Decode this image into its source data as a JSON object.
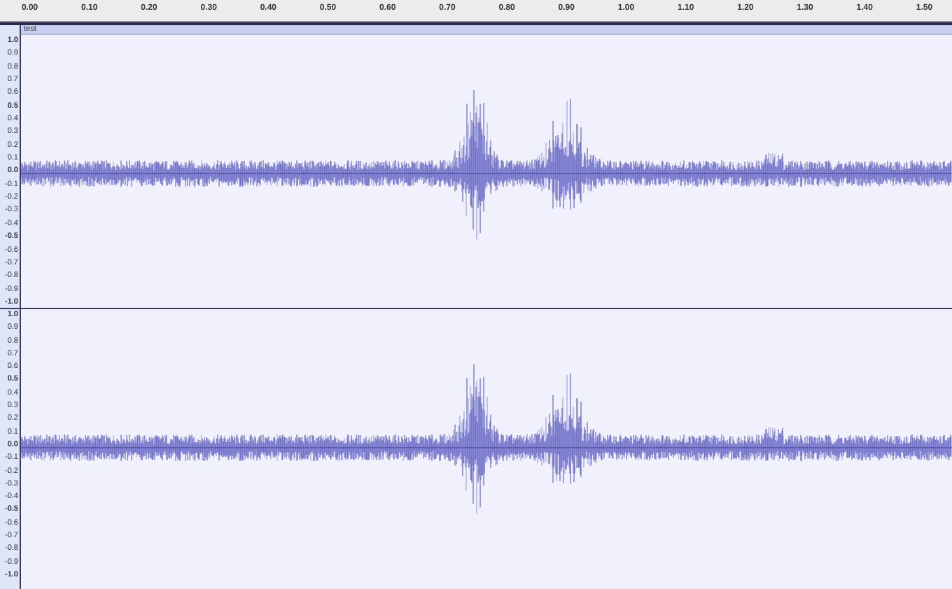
{
  "ruler": {
    "ticks": [
      "0.00",
      "0.10",
      "0.20",
      "0.30",
      "0.40",
      "0.50",
      "0.60",
      "0.70",
      "0.80",
      "0.90",
      "1.00",
      "1.10",
      "1.20",
      "1.30",
      "1.40",
      "1.50"
    ]
  },
  "track": {
    "name": "test"
  },
  "channels": [
    {
      "scale": [
        {
          "text": "1.0",
          "major": true
        },
        {
          "text": "0.9",
          "major": false
        },
        {
          "text": "0.8",
          "major": false
        },
        {
          "text": "0.7",
          "major": false
        },
        {
          "text": "0.6",
          "major": false
        },
        {
          "text": "0.5",
          "major": true
        },
        {
          "text": "0.4",
          "major": false
        },
        {
          "text": "0.3",
          "major": false
        },
        {
          "text": "0.2",
          "major": false
        },
        {
          "text": "0.1",
          "major": false
        },
        {
          "text": "0.0",
          "major": true
        },
        {
          "text": "-0.1",
          "major": false
        },
        {
          "text": "-0.2",
          "major": false
        },
        {
          "text": "-0.3",
          "major": false
        },
        {
          "text": "-0.4",
          "major": false
        },
        {
          "text": "-0.5",
          "major": true
        },
        {
          "text": "-0.6",
          "major": false
        },
        {
          "text": "-0.7",
          "major": false
        },
        {
          "text": "-0.8",
          "major": false
        },
        {
          "text": "-0.9",
          "major": false
        },
        {
          "text": "-1.0",
          "major": true
        }
      ]
    },
    {
      "scale": [
        {
          "text": "1.0",
          "major": true
        },
        {
          "text": "0.9",
          "major": false
        },
        {
          "text": "0.8",
          "major": false
        },
        {
          "text": "0.7",
          "major": false
        },
        {
          "text": "0.6",
          "major": false
        },
        {
          "text": "0.5",
          "major": true
        },
        {
          "text": "0.4",
          "major": false
        },
        {
          "text": "0.3",
          "major": false
        },
        {
          "text": "0.2",
          "major": false
        },
        {
          "text": "0.1",
          "major": false
        },
        {
          "text": "0.0",
          "major": true
        },
        {
          "text": "-0.1",
          "major": false
        },
        {
          "text": "-0.2",
          "major": false
        },
        {
          "text": "-0.3",
          "major": false
        },
        {
          "text": "-0.4",
          "major": false
        },
        {
          "text": "-0.5",
          "major": true
        },
        {
          "text": "-0.6",
          "major": false
        },
        {
          "text": "-0.7",
          "major": false
        },
        {
          "text": "-0.8",
          "major": false
        },
        {
          "text": "-0.9",
          "major": false
        },
        {
          "text": "-1.0",
          "major": true
        }
      ]
    }
  ]
}
